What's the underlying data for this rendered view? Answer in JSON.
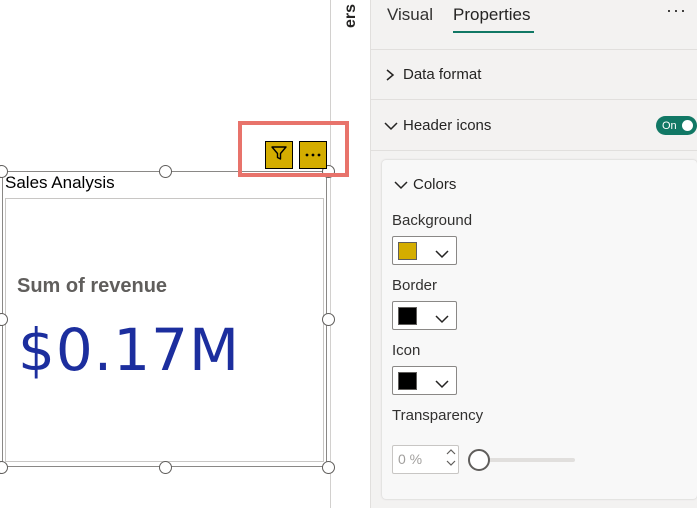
{
  "canvas": {
    "filters_label": "ers",
    "visual": {
      "title": "Sales Analysis",
      "card_label": "Sum of revenue",
      "card_value": "$0.17M"
    },
    "header_icons": [
      {
        "icon": "filter-icon"
      },
      {
        "icon": "more-options-icon"
      }
    ]
  },
  "pane": {
    "tabs": [
      {
        "label": "Visual",
        "active": false
      },
      {
        "label": "Properties",
        "active": true
      }
    ],
    "more_label": "···",
    "sections": {
      "data_format": {
        "label": "Data format",
        "expanded": false
      },
      "header_icons": {
        "label": "Header icons",
        "expanded": true,
        "toggle_label": "On",
        "toggle_on": true
      }
    },
    "colors": {
      "heading": "Colors",
      "background_label": "Background",
      "background_color": "#d4ad00",
      "border_label": "Border",
      "border_color": "#000000",
      "icon_label": "Icon",
      "icon_color": "#000000",
      "transparency_label": "Transparency",
      "transparency_value": "0 %"
    }
  },
  "colors": {
    "accent": "#117865",
    "highlight": "#e8736b",
    "value_text": "#1c2e9e"
  }
}
